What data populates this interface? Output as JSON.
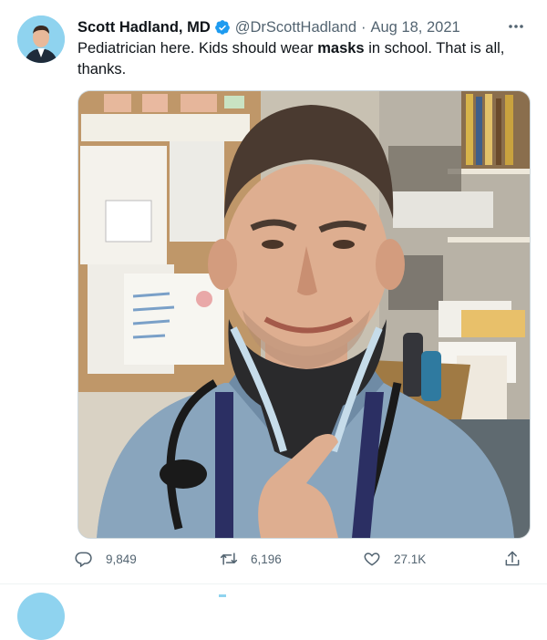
{
  "tweet": {
    "author_name": "Scott Hadland, MD",
    "handle": "@DrScottHadland",
    "separator": "·",
    "date": "Aug 18, 2021",
    "text_before": "Pediatrician here. Kids should wear ",
    "text_bold": "masks",
    "text_after": " in school. That is all, thanks.",
    "verified_color": "#1d9bf0",
    "media": "photo",
    "stats": {
      "replies": "9,849",
      "retweets": "6,196",
      "likes": "27.1K"
    }
  },
  "icons": {
    "verified": "verified-badge-icon",
    "more": "more-options-icon",
    "reply": "reply-icon",
    "retweet": "retweet-icon",
    "like": "heart-icon",
    "share": "share-icon"
  }
}
